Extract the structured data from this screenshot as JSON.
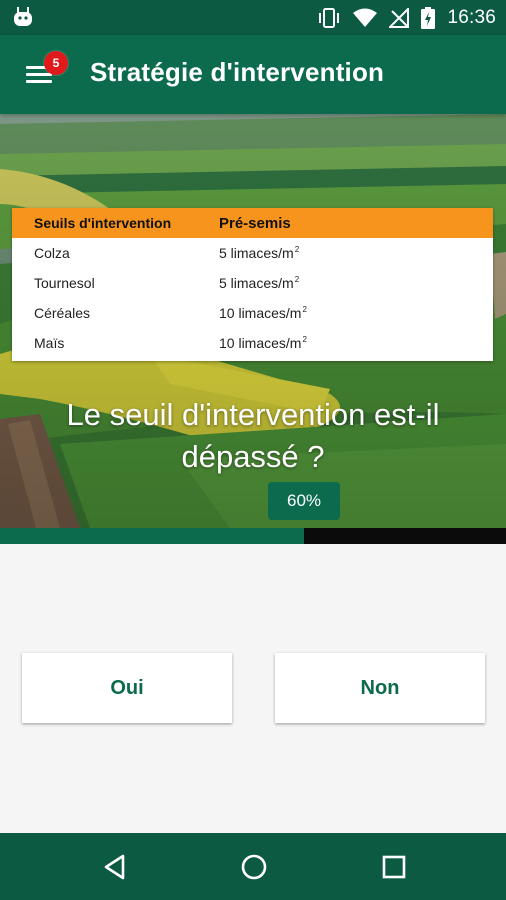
{
  "status_bar": {
    "time": "16:36",
    "icons": [
      "android-icon",
      "vibrate-icon",
      "wifi-icon",
      "no-signal-icon",
      "battery-charging-icon"
    ]
  },
  "app_bar": {
    "title": "Stratégie d'intervention",
    "menu_icon": "hamburger-menu-icon",
    "badge_count": "5"
  },
  "thresholds_table": {
    "header": {
      "col1": "Seuils d'intervention",
      "col2": "Pré-semis"
    },
    "unit_suffix": "2",
    "rows": [
      {
        "crop": "Colza",
        "value": "5 limaces/m"
      },
      {
        "crop": "Tournesol",
        "value": "5 limaces/m"
      },
      {
        "crop": "Céréales",
        "value": "10 limaces/m"
      },
      {
        "crop": "Maïs",
        "value": "10 limaces/m"
      }
    ],
    "header_color": "#f7941d"
  },
  "question": {
    "line1": "Le seuil d'intervention est-il",
    "line2": "dépassé ?"
  },
  "progress": {
    "label": "60%",
    "fraction": 0.6
  },
  "answers": {
    "yes_label": "Oui",
    "no_label": "Non"
  },
  "nav_bar": {
    "icons": [
      "back-icon",
      "home-icon",
      "recents-icon"
    ]
  },
  "colors": {
    "primary": "#0d6b4d",
    "primary_dark": "#0b5a41",
    "badge": "#e01a1a"
  }
}
